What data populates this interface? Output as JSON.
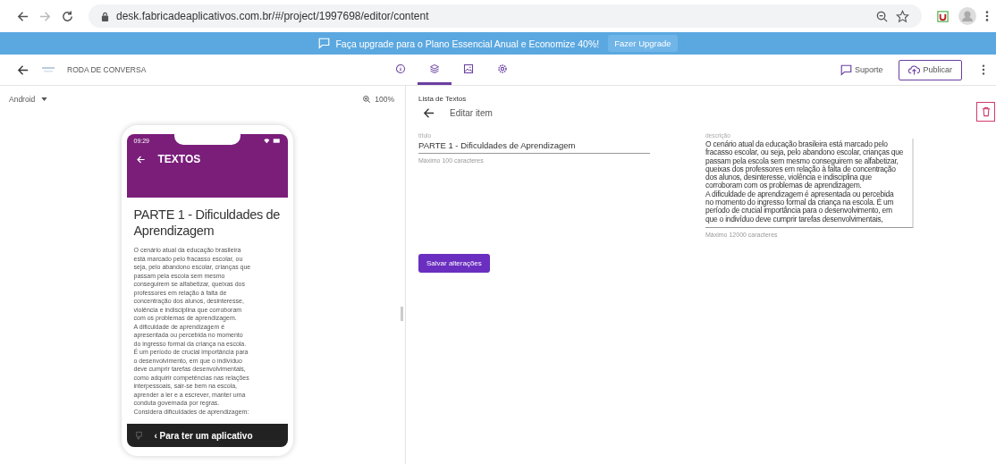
{
  "browser": {
    "url": "desk.fabricadeaplicativos.com.br/#/project/1997698/editor/content"
  },
  "banner": {
    "text": "Faça upgrade para o Plano Essencial Anual e Economize 40%!",
    "button": "Fazer Upgrade"
  },
  "header": {
    "project": "RODA DE CONVERSA",
    "tabs": [
      {
        "kind": "info",
        "selected": false
      },
      {
        "kind": "layers",
        "selected": true
      },
      {
        "kind": "image",
        "selected": false
      },
      {
        "kind": "settings",
        "selected": false
      }
    ],
    "support": "Suporte",
    "publish": "Publicar"
  },
  "preview": {
    "platform": "Android",
    "zoom": "100%",
    "phone": {
      "time": "09:29",
      "screen_title": "TEXTOS",
      "heading": "PARTE 1 - Dificuldades de Aprendizagem",
      "body_lines": [
        "O cenário atual da educação brasileira",
        "está marcado pelo fracasso escolar, ou",
        "seja, pelo abandono escolar, crianças que",
        "passam pela escola sem mesmo",
        "conseguirem se alfabetizar, queixas dos",
        "professores em relação à falta de",
        "concentração dos alunos, desinteresse,",
        "violência e indisciplina que corroboram",
        "com os problemas de aprendizagem.",
        "A dificuldade de aprendizagem é",
        "apresentada ou percebida no momento",
        "do ingresso formal da criança na escola.",
        "É um período de crucial importância para",
        "o desenvolvimento, em que o indivíduo",
        "deve cumprir tarefas desenvolvimentais,",
        "como adquirir competências nas relações",
        "interpessoais, sair-se bem na escola,",
        "aprender a ler e a escrever, manter uma",
        "conduta governada por regras.",
        "Considera dificuldades de aprendizagem:"
      ],
      "footer": "‹ Para ter um aplicativo"
    }
  },
  "editor": {
    "breadcrumb": "Lista de Textos",
    "title": "Editar item",
    "fields": [
      {
        "label": "título",
        "value": "PARTE 1 - Dificuldades de Aprendizagem",
        "hint": "Máximo 100 caracteres"
      },
      {
        "label": "descrição",
        "value_lines": [
          "O cenário atual da educação brasileira está marcado pelo",
          "fracasso escolar, ou seja, pelo abandono escolar, crianças que",
          "passam pela escola sem mesmo conseguirem se alfabetizar,",
          "queixas dos professores em relação à falta de concentração",
          "dos alunos, desinteresse, violência e indisciplina que",
          "corroboram com os problemas de aprendizagem.",
          "A dificuldade de aprendizagem é apresentada ou percebida",
          "no momento do ingresso formal da criança na escola. É um",
          "período de crucial importância para o desenvolvimento, em",
          "que o indivíduo deve cumprir tarefas desenvolvimentais,"
        ],
        "hint": "Máximo 12000 caracteres"
      }
    ],
    "save": "Salvar alterações"
  }
}
